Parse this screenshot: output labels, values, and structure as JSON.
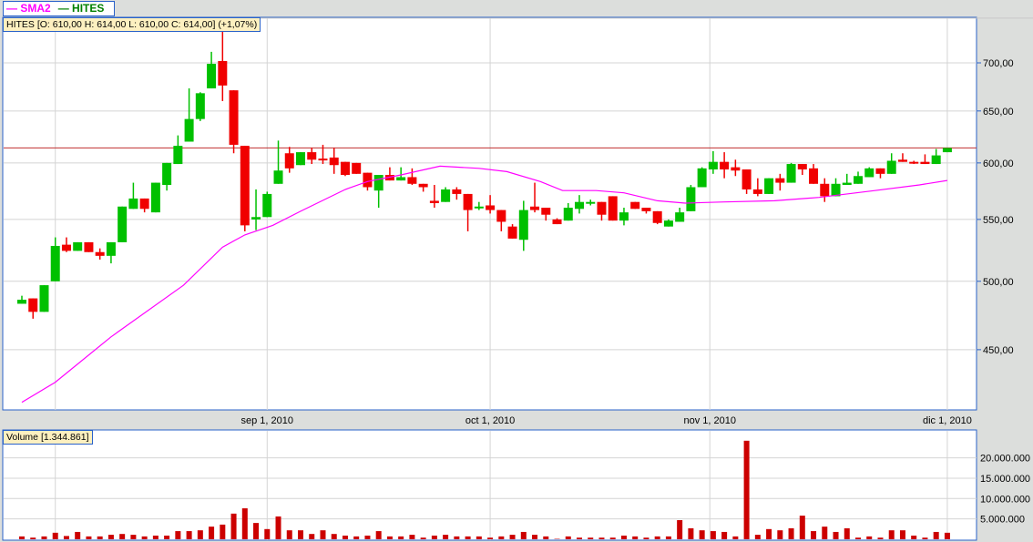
{
  "legend": {
    "sma_label": "SMA2",
    "series_label": "HITES",
    "sma_color": "#ff00ff",
    "series_color": "#008000"
  },
  "info": {
    "text": "HITES [O: 610,00  H: 614,00  L: 610,00  C: 614,00] (+1,07%)"
  },
  "volume_info": {
    "text": "Volume [1.344.861]"
  },
  "chart_data": [
    {
      "type": "candlestick",
      "title": "HITES",
      "scale": "log",
      "ylim": [
        410,
        740
      ],
      "y_ticks": [
        {
          "v": 700,
          "label": "700,00"
        },
        {
          "v": 650,
          "label": "650,00"
        },
        {
          "v": 600,
          "label": "600,00"
        },
        {
          "v": 550,
          "label": "550,00"
        },
        {
          "v": 500,
          "label": "500,00"
        },
        {
          "v": 450,
          "label": "450,00"
        }
      ],
      "extra_gridline": 750,
      "reference_line": 614,
      "x_ticks": [
        {
          "i": 3,
          "label": ""
        },
        {
          "i": 22,
          "label": "sep 1, 2010"
        },
        {
          "i": 42,
          "label": "oct 1, 2010"
        },
        {
          "i": 61.7,
          "label": "nov 1, 2010"
        },
        {
          "i": 83,
          "label": "dic 1, 2010"
        }
      ],
      "colors": {
        "up": "#00c000",
        "down": "#f00000",
        "sma": "#ff00ff",
        "reference": "#c03030"
      },
      "ohlc": [
        [
          483,
          489,
          483,
          486
        ],
        [
          487,
          487,
          472,
          477
        ],
        [
          477,
          497,
          477,
          497
        ],
        [
          500,
          535,
          500,
          528
        ],
        [
          529,
          535,
          523,
          524
        ],
        [
          524,
          531,
          524,
          531
        ],
        [
          531,
          531,
          523,
          523
        ],
        [
          523,
          526,
          517,
          520
        ],
        [
          520,
          531,
          514,
          531
        ],
        [
          531,
          561,
          531,
          561
        ],
        [
          559,
          582,
          559,
          568
        ],
        [
          568,
          568,
          556,
          559
        ],
        [
          556,
          582,
          556,
          582
        ],
        [
          580,
          600,
          575,
          600
        ],
        [
          599,
          626,
          599,
          616
        ],
        [
          620,
          673,
          620,
          642
        ],
        [
          642,
          669,
          640,
          668
        ],
        [
          673,
          712,
          673,
          699
        ],
        [
          702,
          735,
          660,
          676
        ],
        [
          671,
          671,
          609,
          617
        ],
        [
          616,
          616,
          540,
          545
        ],
        [
          550,
          576,
          541,
          552
        ],
        [
          552,
          574,
          552,
          572
        ],
        [
          581,
          621,
          581,
          593
        ],
        [
          609,
          615,
          591,
          595
        ],
        [
          598,
          610,
          598,
          610
        ],
        [
          610,
          614,
          599,
          603
        ],
        [
          604,
          617,
          599,
          603
        ],
        [
          605,
          614,
          590,
          598
        ],
        [
          601,
          601,
          588,
          589
        ],
        [
          600,
          600,
          590,
          590
        ],
        [
          591,
          591,
          575,
          578
        ],
        [
          575,
          589,
          560,
          589
        ],
        [
          589,
          596,
          584,
          584
        ],
        [
          584,
          596,
          584,
          587
        ],
        [
          587,
          595,
          580,
          581
        ],
        [
          581,
          581,
          574,
          578
        ],
        [
          566,
          580,
          560,
          564
        ],
        [
          565,
          578,
          565,
          576
        ],
        [
          576,
          578,
          567,
          572
        ],
        [
          572,
          572,
          540,
          558
        ],
        [
          560,
          565,
          558,
          561
        ],
        [
          562,
          571,
          555,
          558
        ],
        [
          558,
          558,
          540,
          548
        ],
        [
          544,
          546,
          534,
          534
        ],
        [
          533,
          566,
          524,
          558
        ],
        [
          561,
          582,
          556,
          558
        ],
        [
          560,
          560,
          549,
          554
        ],
        [
          550,
          551,
          546,
          546
        ],
        [
          549,
          564,
          549,
          560
        ],
        [
          559,
          571,
          555,
          565
        ],
        [
          564,
          567,
          562,
          565
        ],
        [
          565,
          565,
          549,
          554
        ],
        [
          570,
          570,
          549,
          549
        ],
        [
          549,
          560,
          545,
          556
        ],
        [
          565,
          565,
          559,
          559
        ],
        [
          560,
          560,
          555,
          557
        ],
        [
          557,
          557,
          546,
          547
        ],
        [
          544,
          550,
          544,
          549
        ],
        [
          548,
          560,
          548,
          556
        ],
        [
          557,
          580,
          557,
          578
        ],
        [
          578,
          596,
          578,
          595
        ],
        [
          594,
          611,
          590,
          601
        ],
        [
          601,
          610,
          586,
          594
        ],
        [
          596,
          603,
          588,
          593
        ],
        [
          594,
          594,
          572,
          576
        ],
        [
          576,
          586,
          570,
          572
        ],
        [
          572,
          586,
          572,
          586
        ],
        [
          586,
          590,
          575,
          582
        ],
        [
          582,
          600,
          582,
          599
        ],
        [
          599,
          599,
          589,
          594
        ],
        [
          595,
          599,
          581,
          581
        ],
        [
          581,
          586,
          565,
          570
        ],
        [
          570,
          586,
          570,
          581
        ],
        [
          580,
          590,
          580,
          582
        ],
        [
          581,
          592,
          581,
          588
        ],
        [
          587,
          596,
          587,
          595
        ],
        [
          595,
          595,
          586,
          590
        ],
        [
          590,
          609,
          590,
          602
        ],
        [
          603,
          609,
          601,
          601
        ],
        [
          601,
          602,
          599,
          600
        ],
        [
          601,
          608,
          599,
          599
        ],
        [
          599,
          613,
          599,
          607
        ],
        [
          610,
          614,
          610,
          614
        ]
      ],
      "sma": {
        "name": "SMA2",
        "points": [
          [
            0,
            415
          ],
          [
            3,
            428
          ],
          [
            8,
            459
          ],
          [
            14.5,
            497
          ],
          [
            18,
            527
          ],
          [
            20,
            537
          ],
          [
            22.5,
            545
          ],
          [
            25,
            557
          ],
          [
            29,
            576
          ],
          [
            31,
            583
          ],
          [
            34,
            589
          ],
          [
            37.5,
            597
          ],
          [
            41,
            595
          ],
          [
            43.5,
            592
          ],
          [
            46.5,
            583
          ],
          [
            48.5,
            575
          ],
          [
            51.5,
            575
          ],
          [
            54,
            573
          ],
          [
            57,
            566
          ],
          [
            59.5,
            564
          ],
          [
            63,
            565
          ],
          [
            67.5,
            566
          ],
          [
            71.5,
            569
          ],
          [
            76.5,
            575
          ],
          [
            80.5,
            580
          ],
          [
            83,
            584
          ]
        ]
      }
    },
    {
      "type": "bar",
      "title": "Volume",
      "unit": "millions",
      "ylim": [
        0,
        25
      ],
      "y_ticks": [
        {
          "v": 20,
          "label": "20.000.000"
        },
        {
          "v": 15,
          "label": "15.000.000"
        },
        {
          "v": 10,
          "label": "10.000.000"
        },
        {
          "v": 5,
          "label": "5.000.000"
        }
      ],
      "color": "#cc0000",
      "values": [
        0.7,
        0.4,
        0.7,
        1.6,
        0.8,
        1.8,
        0.7,
        0.7,
        1.1,
        1.3,
        1.1,
        0.7,
        0.9,
        0.9,
        2.0,
        2.0,
        2.2,
        3.1,
        3.6,
        6.3,
        7.6,
        4.0,
        2.5,
        5.6,
        2.2,
        2.2,
        1.3,
        2.2,
        1.3,
        0.9,
        0.7,
        0.9,
        2.0,
        0.7,
        0.7,
        1.1,
        0.4,
        0.9,
        1.1,
        0.7,
        0.7,
        0.7,
        0.4,
        0.7,
        1.1,
        1.8,
        1.1,
        0.7,
        0.1,
        0.7,
        0.4,
        0.4,
        0.4,
        0.4,
        0.9,
        0.7,
        0.4,
        0.7,
        0.7,
        4.7,
        2.7,
        2.2,
        2.0,
        1.8,
        0.7,
        24.2,
        1.1,
        2.5,
        2.2,
        2.7,
        5.8,
        2.0,
        3.1,
        1.8,
        2.7,
        0.4,
        0.7,
        0.4,
        2.2,
        2.2,
        0.9,
        0.4,
        1.8,
        1.6
      ]
    }
  ]
}
